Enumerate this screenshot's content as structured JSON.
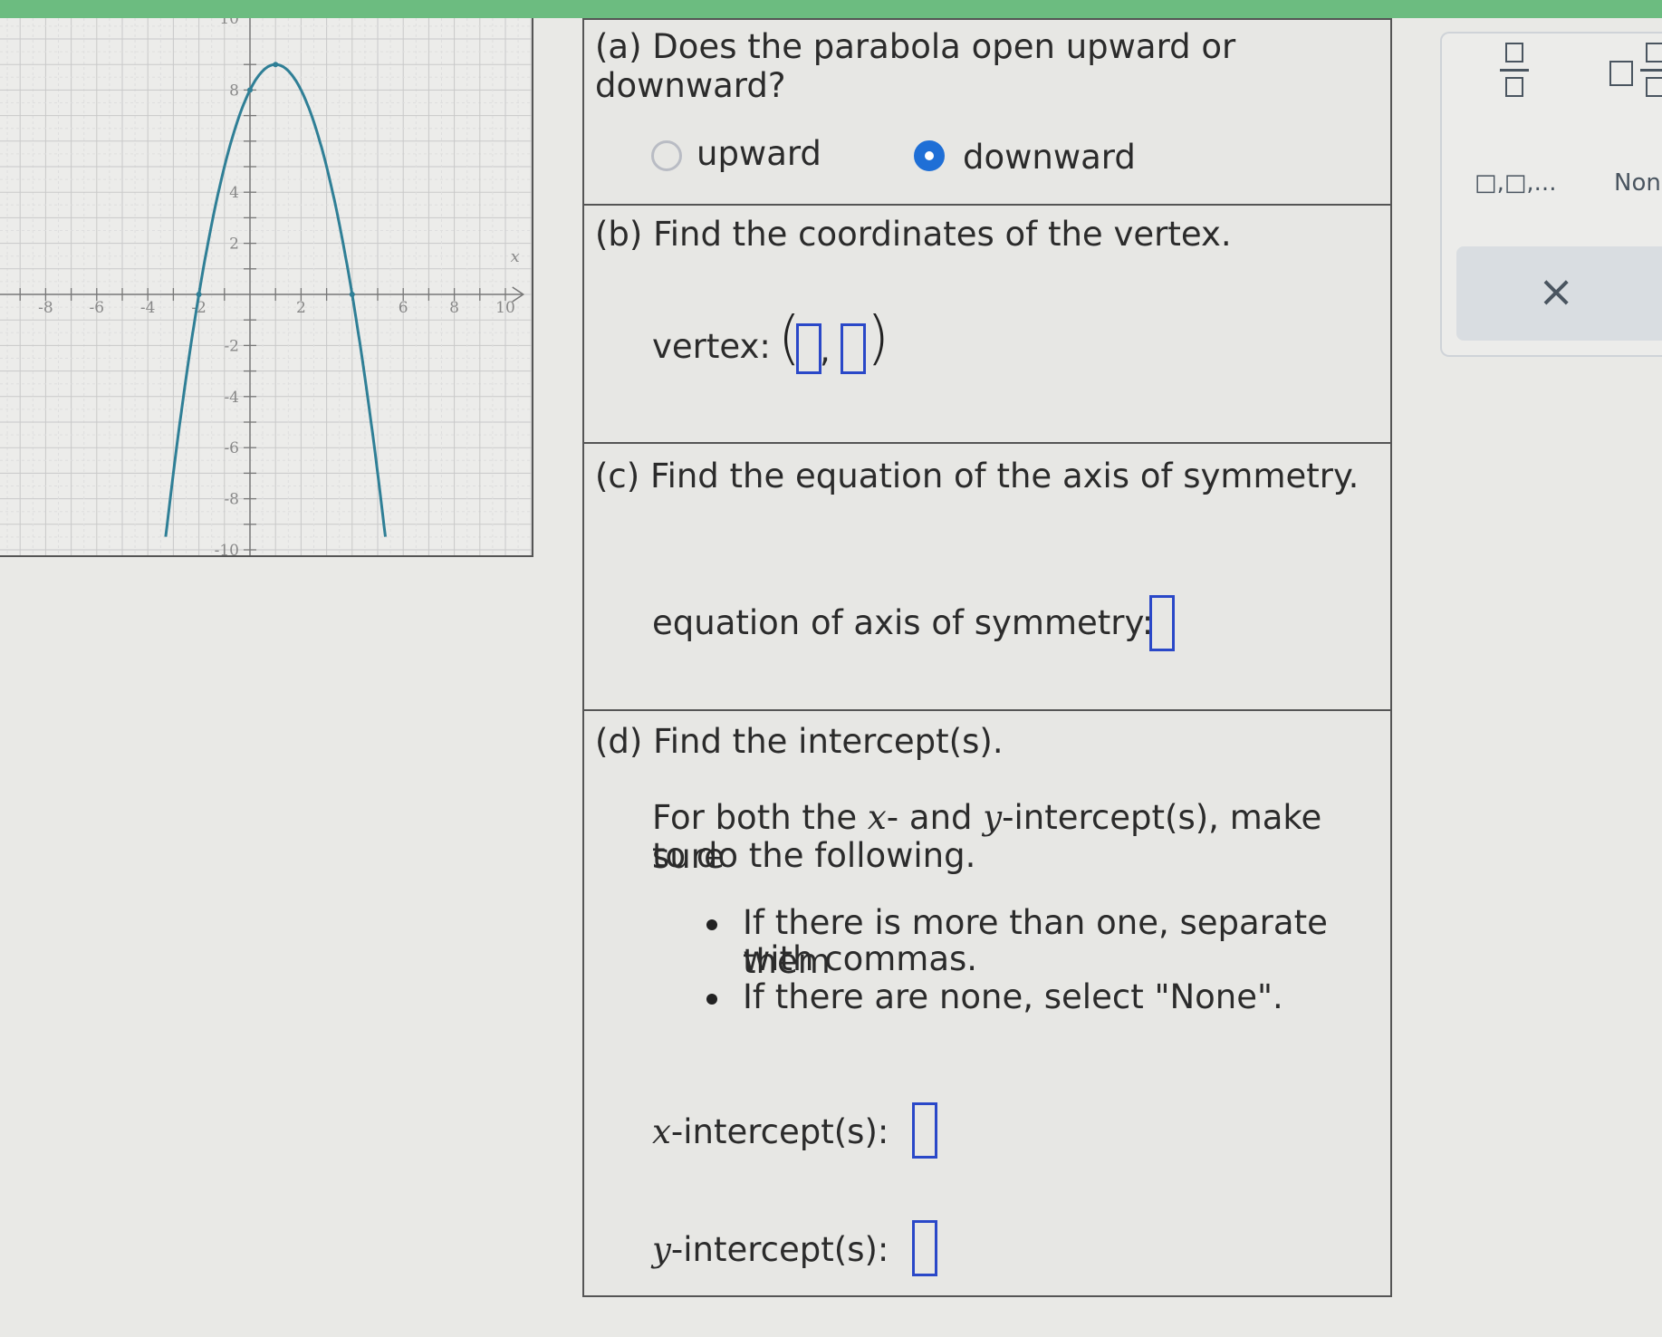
{
  "graph": {
    "x_axis_label": "x",
    "x_tick_labels": [
      "-8",
      "-6",
      "-4",
      "-2",
      "2",
      "6",
      "8",
      "10"
    ],
    "y_tick_labels": [
      "8",
      "4",
      "2",
      "-2",
      "-4",
      "-6",
      "-8",
      "-10"
    ],
    "top_tick_label": "10",
    "x_range": [
      -10,
      10
    ],
    "y_range": [
      -10,
      10
    ],
    "curve_color": "#2f7f96"
  },
  "part_a": {
    "question": "(a) Does the parabola open upward or downward?",
    "option_upward": "upward",
    "option_downward": "downward",
    "selected": "downward"
  },
  "part_b": {
    "question": "(b) Find the coordinates of the vertex.",
    "vertex_label": "vertex:",
    "open_paren": "(",
    "comma": ",",
    "close_paren": ")"
  },
  "part_c": {
    "question": "(c) Find the equation of the axis of symmetry.",
    "axis_label": "equation of axis of symmetry:"
  },
  "part_d": {
    "question": "(d) Find the intercept(s).",
    "instr_line1_a": "For both the ",
    "instr_x": "x",
    "instr_line1_b": "- and ",
    "instr_y": "y",
    "instr_line1_c": "-intercept(s), make sure",
    "instr_line2": "to do the following.",
    "bullet1_line1": "If there is more than one, separate them",
    "bullet1_line2": "with commas.",
    "bullet2": "If there are none, select \"None\".",
    "x_label_var": "x",
    "x_label_rest": "-intercept(s):",
    "y_label_var": "y",
    "y_label_rest": "-intercept(s):"
  },
  "tools": {
    "list_label": "□,□,...",
    "none_label": "None",
    "clear_icon": "×"
  },
  "colors": {
    "accent_bar": "#6cbc80",
    "input_border": "#2a48c8",
    "radio_selected": "#1f6fd6"
  }
}
